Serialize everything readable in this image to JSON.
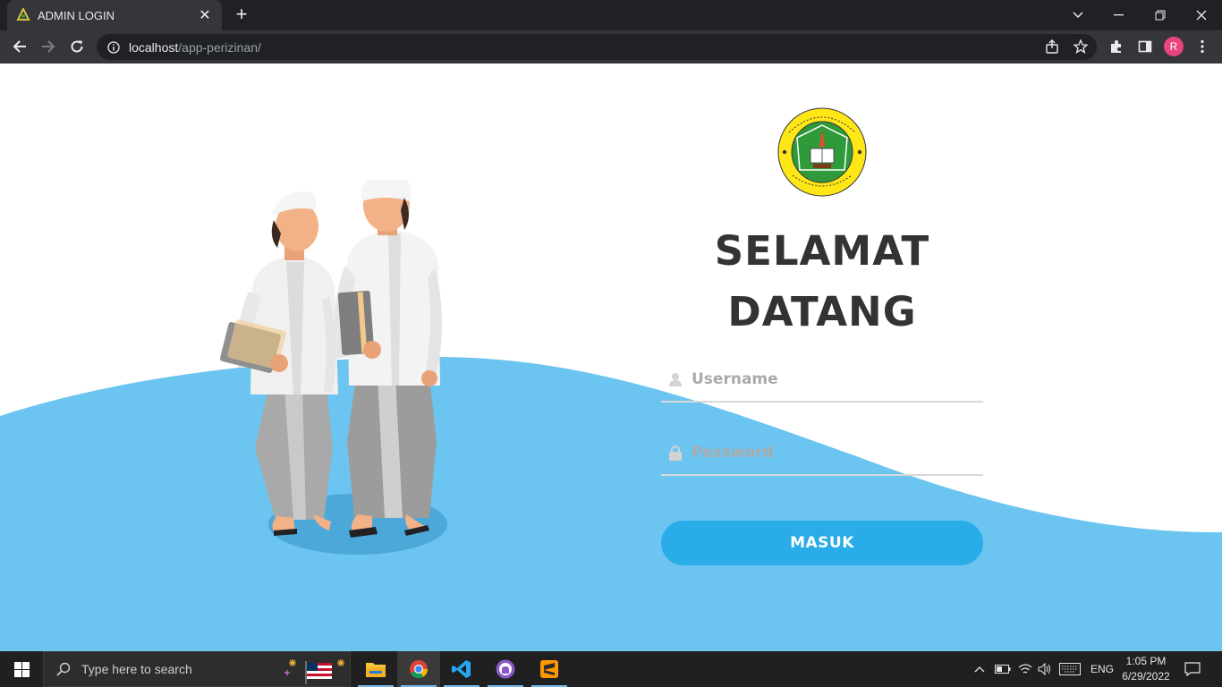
{
  "browser": {
    "tab_title": "ADMIN LOGIN",
    "url_host": "localhost",
    "url_path": "/app-perizinan/",
    "profile_initial": "R"
  },
  "page": {
    "logo_ring_text": "PONDOK PESANTREN NURUL ABROR AL-ROBBANIYIN",
    "logo_bottom_text": "ALASBULUH · WONGSOREJO · BANYUWANGI",
    "welcome_line1": "SELAMAT",
    "welcome_line2": "DATANG",
    "username_placeholder": "Username",
    "password_placeholder": "Password",
    "login_button": "MASUK",
    "colors": {
      "wave": "#6cc5f0",
      "button": "#2aace8",
      "heading": "#333333"
    }
  },
  "taskbar": {
    "search_placeholder": "Type here to search",
    "language": "ENG",
    "time": "1:05 PM",
    "date": "6/29/2022",
    "apps": [
      "file-explorer",
      "chrome",
      "vscode",
      "github-desktop",
      "sublime-text"
    ]
  }
}
